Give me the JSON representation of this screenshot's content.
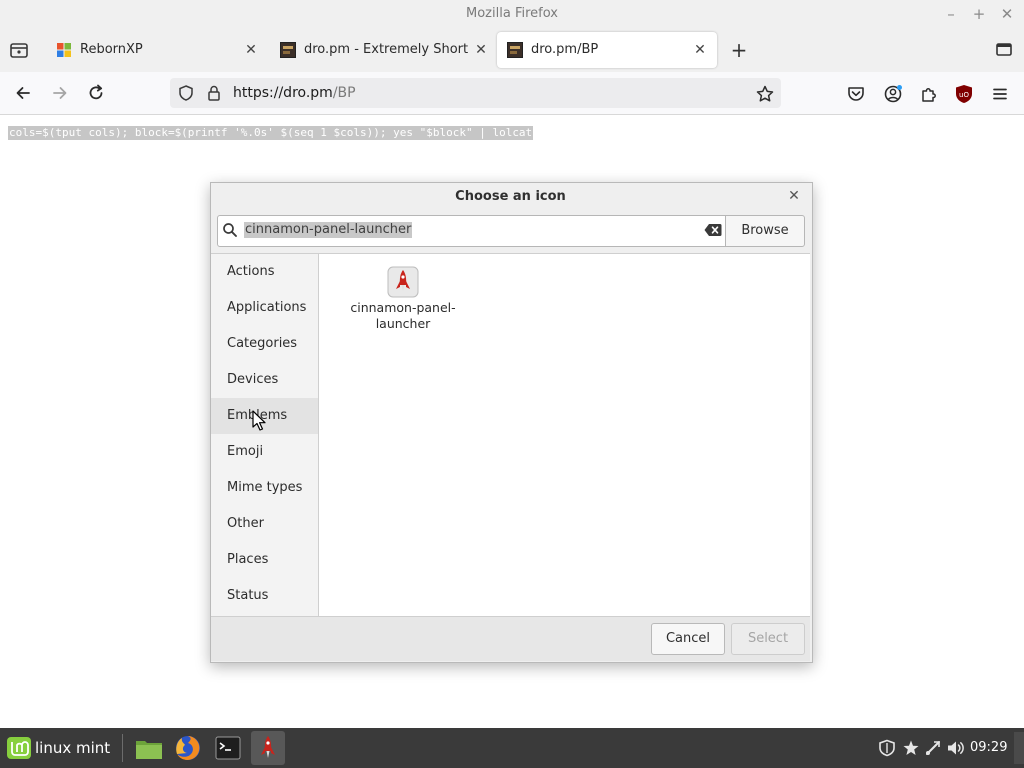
{
  "window": {
    "title": "Mozilla Firefox",
    "minimize_icon": "minimize-icon",
    "maximize_icon": "maximize-icon",
    "close_icon": "close-icon"
  },
  "tabs": [
    {
      "label": "RebornXP",
      "favicon": "windows-xp-favicon",
      "active": false
    },
    {
      "label": "dro.pm - Extremely Short Li",
      "favicon": "dropm-favicon",
      "active": false
    },
    {
      "label": "dro.pm/BP",
      "favicon": "dropm-favicon",
      "active": true
    }
  ],
  "nav": {
    "url_prefix": "https://dro.pm",
    "url_path": "/BP"
  },
  "page": {
    "command": "cols=$(tput cols); block=$(printf '%.0s' $(seq 1 $cols)); yes \"$block\" | lolcat"
  },
  "dialog": {
    "title": "Choose an icon",
    "search_value": "cinnamon-panel-launcher",
    "browse_label": "Browse",
    "categories": [
      "Actions",
      "Applications",
      "Categories",
      "Devices",
      "Emblems",
      "Emoji",
      "Mime types",
      "Other",
      "Places",
      "Status"
    ],
    "hovered_category": "Emblems",
    "result": {
      "line1": "cinnamon-panel-",
      "line2": "launcher"
    },
    "cancel_label": "Cancel",
    "select_label": "Select"
  },
  "taskbar": {
    "menu_label": "linux mint",
    "clock": "09:29"
  },
  "colors": {
    "taskbar": "#3a3a3a",
    "mint_green": "#87cf3e",
    "rocket_red": "#c8241c"
  }
}
